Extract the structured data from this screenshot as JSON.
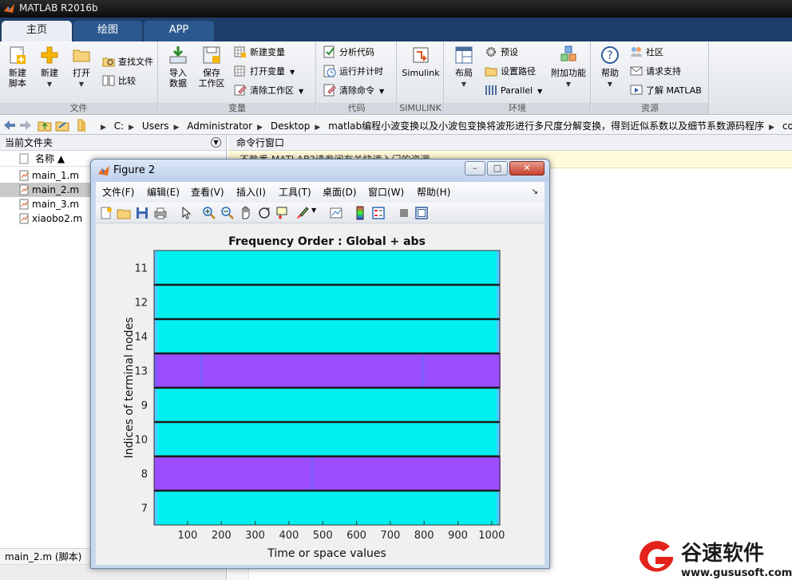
{
  "app": {
    "title": "MATLAB R2016b"
  },
  "ribbon_tabs": [
    "主页",
    "绘图",
    "APP"
  ],
  "ribbon": {
    "groups": {
      "file": "文件",
      "variable": "变量",
      "code": "代码",
      "simulink": "SIMULINK",
      "environment": "环境",
      "resources": "资源"
    },
    "new_script": "新建\n脚本",
    "new_script_1": "新建",
    "new_script_2": "脚本",
    "new": "新建",
    "open": "打开",
    "find_files": "查找文件",
    "compare": "比较",
    "import_1": "导入",
    "import_2": "数据",
    "save_1": "保存",
    "save_2": "工作区",
    "new_variable": "新建变量",
    "open_variable": "打开变量",
    "clear_workspace": "清除工作区",
    "analyze_code": "分析代码",
    "run_time": "运行并计时",
    "clear_commands": "清除命令",
    "simulink": "Simulink",
    "layout": "布局",
    "preferences": "预设",
    "set_path": "设置路径",
    "parallel": "Parallel",
    "addons": "附加功能",
    "help": "帮助",
    "community": "社区",
    "request_support": "请求支持",
    "learn_matlab": "了解 MATLAB"
  },
  "address": {
    "crumbs": [
      "C:",
      "Users",
      "Administrator",
      "Desktop",
      "matlab编程小波变换以及小波包变换将波形进行多尺度分解变换，得到近似系数以及细节系数源码程序",
      "code"
    ]
  },
  "current_folder": {
    "title": "当前文件夹",
    "column": "名称 ▲",
    "files": [
      "main_1.m",
      "main_2.m",
      "main_3.m",
      "xiaobo2.m"
    ],
    "selected_index": 1,
    "footer": "main_2.m  (脚本)"
  },
  "command_window": {
    "title": "命令行窗口",
    "notice": "不熟悉 MATLAB?请参阅有关快速入门的资源。"
  },
  "figure": {
    "title": "Figure 2",
    "menu": [
      "文件(F)",
      "编辑(E)",
      "查看(V)",
      "插入(I)",
      "工具(T)",
      "桌面(D)",
      "窗口(W)",
      "帮助(H)"
    ],
    "window_buttons": {
      "minimize": "–",
      "maximize": "□",
      "close": "✕"
    }
  },
  "chart_data": {
    "type": "heatmap",
    "title": "Frequency Order : Global + abs",
    "xlabel": "Time or space values",
    "ylabel": "Indices of terminal nodes",
    "xlim": [
      1,
      1024
    ],
    "xticks": [
      100,
      200,
      300,
      400,
      500,
      600,
      700,
      800,
      900,
      1000
    ],
    "rows_top_to_bottom": [
      "11",
      "12",
      "14",
      "13",
      "9",
      "10",
      "8",
      "7"
    ],
    "row_colors": [
      "#00f0f0",
      "#00f0f0",
      "#00f0f0",
      "striped",
      "#00f0f0",
      "#00f0f0",
      "striped",
      "#00f0f0"
    ],
    "stripe_colors": [
      "#9b4dff",
      "#7a5cff",
      "#5aa0ff",
      "#c04df0"
    ],
    "separator_color": "#1a1a1a"
  },
  "watermark": {
    "brand": "谷速软件",
    "url": "www.gususoft.com"
  }
}
